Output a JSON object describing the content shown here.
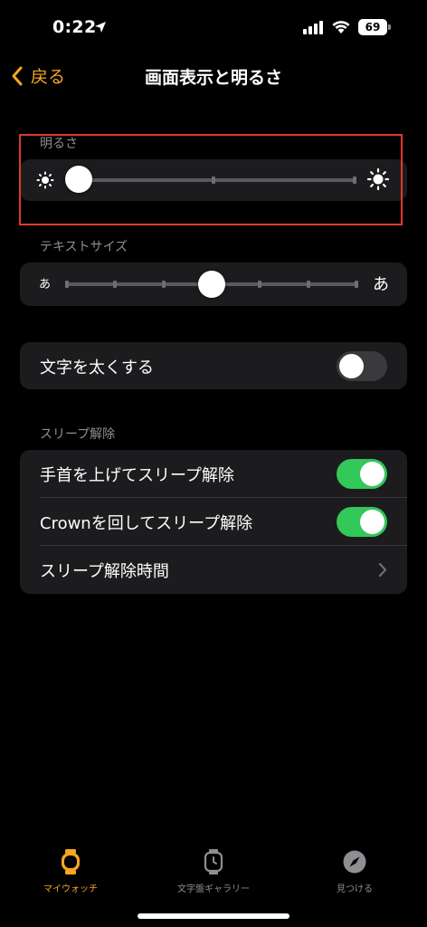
{
  "status_bar": {
    "time": "0:22",
    "battery": "69",
    "icons": [
      "location-arrow-icon",
      "cellular-signal-icon",
      "wifi-icon",
      "battery-icon"
    ]
  },
  "nav": {
    "back_label": "戻る",
    "title": "画面表示と明るさ"
  },
  "brightness": {
    "label": "明るさ",
    "value_fraction": 0.03,
    "ticks": 3,
    "icons": [
      "sun-small-icon",
      "sun-large-icon"
    ]
  },
  "text_size": {
    "label": "テキストサイズ",
    "small_glyph": "あ",
    "large_glyph": "あ",
    "value_step": 3,
    "steps": 7
  },
  "bold_text": {
    "label": "文字を太くする",
    "on": false
  },
  "wake": {
    "section_label": "スリープ解除",
    "items": [
      {
        "label": "手首を上げてスリープ解除",
        "type": "toggle",
        "on": true
      },
      {
        "label": "Crownを回してスリープ解除",
        "type": "toggle",
        "on": true
      },
      {
        "label": "スリープ解除時間",
        "type": "disclosure"
      }
    ]
  },
  "tab_bar": {
    "active_color": "#f5a623",
    "inactive_color": "#8e8e93",
    "tabs": [
      {
        "label": "マイウォッチ",
        "icon": "watch-icon",
        "active": true
      },
      {
        "label": "文字盤ギャラリー",
        "icon": "watch-face-icon",
        "active": false
      },
      {
        "label": "見つける",
        "icon": "compass-icon",
        "active": false
      }
    ]
  },
  "colors": {
    "accent": "#f5a623",
    "toggle_on": "#34c759",
    "highlight_border": "#e0392b"
  }
}
